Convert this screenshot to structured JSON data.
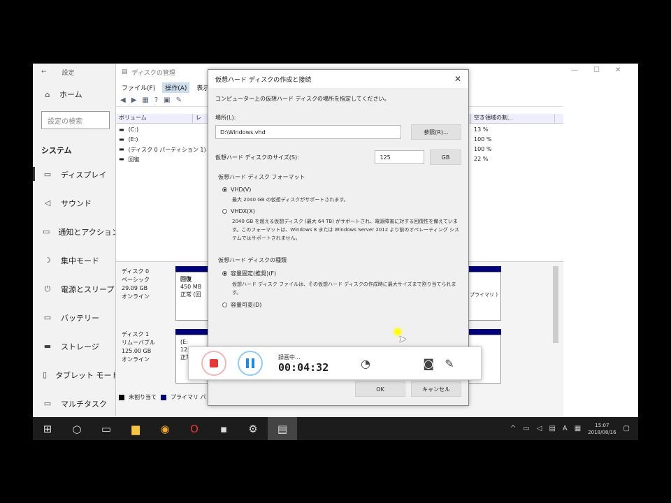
{
  "settings": {
    "title": "設定",
    "home": "ホーム",
    "search_placeholder": "設定の検索",
    "section": "システム",
    "items": [
      {
        "label": "ディスプレイ",
        "icon": "monitor-icon",
        "glyph": "▭"
      },
      {
        "label": "サウンド",
        "icon": "speaker-icon",
        "glyph": "◁"
      },
      {
        "label": "通知とアクション",
        "icon": "notification-icon",
        "glyph": "▭"
      },
      {
        "label": "集中モード",
        "icon": "moon-icon",
        "glyph": "☽"
      },
      {
        "label": "電源とスリープ",
        "icon": "power-icon",
        "glyph": "⏻"
      },
      {
        "label": "バッテリー",
        "icon": "battery-icon",
        "glyph": "▭"
      },
      {
        "label": "ストレージ",
        "icon": "storage-icon",
        "glyph": "▬"
      },
      {
        "label": "タブレット モード",
        "icon": "tablet-icon",
        "glyph": "▯"
      },
      {
        "label": "マルチタスク",
        "icon": "multitask-icon",
        "glyph": "▭"
      }
    ]
  },
  "diskmgmt": {
    "title": "ディスクの管理",
    "menu": [
      "ファイル(F)",
      "操作(A)",
      "表示(V)"
    ],
    "col_volume": "ボリューム",
    "col_layout": "レ",
    "col_pct": "空き領域の割...",
    "volumes": [
      {
        "name": "(C:)",
        "pct": "13 %"
      },
      {
        "name": "(E:)",
        "pct": "100 %"
      },
      {
        "name": "(ディスク 0 パーティション 1)",
        "pct": "100 %"
      },
      {
        "name": "回復",
        "pct": "22 %"
      }
    ],
    "disk0": {
      "name": "ディスク 0",
      "type": "ベーシック",
      "size": "29.09 GB",
      "status": "オンライン",
      "part_title": "回復",
      "part_size": "450 MB",
      "part_status": "正常 (回",
      "right_text": "プライマリ )"
    },
    "disk1": {
      "name": "ディスク 1",
      "type": "リムーバブル",
      "size": "125.00 GB",
      "status": "オンライン",
      "part_title": "(E:",
      "part_size": "125",
      "part_status": "正常"
    },
    "legend": [
      {
        "label": "未割り当て",
        "color": "#000000"
      },
      {
        "label": "プライマリ パ",
        "color": "#00007a"
      }
    ]
  },
  "dialog": {
    "title": "仮想ハード ディスクの作成と接続",
    "description": "コンピューター上の仮想ハード ディスクの場所を指定してください。",
    "location_label": "場所(L):",
    "location_value": "D:\\Windows.vhd",
    "browse_label": "参照(R)...",
    "size_label": "仮想ハード ディスクのサイズ(S):",
    "size_value": "125",
    "size_unit": "GB",
    "format_title": "仮想ハード ディスク フォーマット",
    "vhd_label": "VHD(V)",
    "vhd_desc": "最大 2040 GB の仮想ディスクがサポートされます。",
    "vhdx_label": "VHDX(X)",
    "vhdx_desc": "2040 GB を超える仮想ディスク (最大 64 TB) がサポートされ、電源障害に対する回復性を備えています。このフォーマットは、Windows 8 または Windows Server 2012 より前のオペレーティング システムではサポートされません。",
    "type_title": "仮想ハード ディスクの種類",
    "fixed_label": "容量固定(推奨)(F)",
    "fixed_desc": "仮想ハード ディスク ファイルは、その仮想ハード ディスクの作成時に最大サイズまで割り当てられます。",
    "dynamic_label": "容量可変(D)",
    "ok_label": "OK",
    "cancel_label": "キャンセル"
  },
  "recorder": {
    "status": "録画中...",
    "time": "00:04:32"
  },
  "taskbar": {
    "time": "15:07",
    "date": "2018/08/16",
    "ime": "A",
    "icons": [
      {
        "name": "start-icon",
        "glyph": "⊞"
      },
      {
        "name": "search-icon",
        "glyph": "○"
      },
      {
        "name": "task-view-icon",
        "glyph": "▭"
      },
      {
        "name": "file-explorer-icon",
        "glyph": "▆"
      },
      {
        "name": "chrome-icon",
        "glyph": "◉"
      },
      {
        "name": "opera-icon",
        "glyph": "O"
      },
      {
        "name": "app-icon",
        "glyph": "▪"
      },
      {
        "name": "settings-gear-icon",
        "glyph": "⚙"
      },
      {
        "name": "disk-app-icon",
        "glyph": "▤"
      }
    ]
  }
}
